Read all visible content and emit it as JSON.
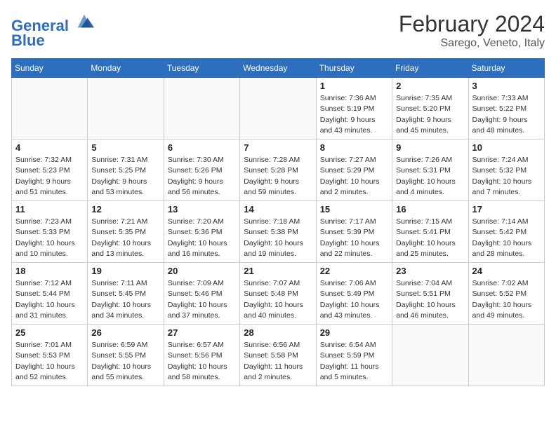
{
  "header": {
    "logo_line1": "General",
    "logo_line2": "Blue",
    "month": "February 2024",
    "location": "Sarego, Veneto, Italy"
  },
  "weekdays": [
    "Sunday",
    "Monday",
    "Tuesday",
    "Wednesday",
    "Thursday",
    "Friday",
    "Saturday"
  ],
  "weeks": [
    [
      {
        "day": "",
        "info": ""
      },
      {
        "day": "",
        "info": ""
      },
      {
        "day": "",
        "info": ""
      },
      {
        "day": "",
        "info": ""
      },
      {
        "day": "1",
        "info": "Sunrise: 7:36 AM\nSunset: 5:19 PM\nDaylight: 9 hours\nand 43 minutes."
      },
      {
        "day": "2",
        "info": "Sunrise: 7:35 AM\nSunset: 5:20 PM\nDaylight: 9 hours\nand 45 minutes."
      },
      {
        "day": "3",
        "info": "Sunrise: 7:33 AM\nSunset: 5:22 PM\nDaylight: 9 hours\nand 48 minutes."
      }
    ],
    [
      {
        "day": "4",
        "info": "Sunrise: 7:32 AM\nSunset: 5:23 PM\nDaylight: 9 hours\nand 51 minutes."
      },
      {
        "day": "5",
        "info": "Sunrise: 7:31 AM\nSunset: 5:25 PM\nDaylight: 9 hours\nand 53 minutes."
      },
      {
        "day": "6",
        "info": "Sunrise: 7:30 AM\nSunset: 5:26 PM\nDaylight: 9 hours\nand 56 minutes."
      },
      {
        "day": "7",
        "info": "Sunrise: 7:28 AM\nSunset: 5:28 PM\nDaylight: 9 hours\nand 59 minutes."
      },
      {
        "day": "8",
        "info": "Sunrise: 7:27 AM\nSunset: 5:29 PM\nDaylight: 10 hours\nand 2 minutes."
      },
      {
        "day": "9",
        "info": "Sunrise: 7:26 AM\nSunset: 5:31 PM\nDaylight: 10 hours\nand 4 minutes."
      },
      {
        "day": "10",
        "info": "Sunrise: 7:24 AM\nSunset: 5:32 PM\nDaylight: 10 hours\nand 7 minutes."
      }
    ],
    [
      {
        "day": "11",
        "info": "Sunrise: 7:23 AM\nSunset: 5:33 PM\nDaylight: 10 hours\nand 10 minutes."
      },
      {
        "day": "12",
        "info": "Sunrise: 7:21 AM\nSunset: 5:35 PM\nDaylight: 10 hours\nand 13 minutes."
      },
      {
        "day": "13",
        "info": "Sunrise: 7:20 AM\nSunset: 5:36 PM\nDaylight: 10 hours\nand 16 minutes."
      },
      {
        "day": "14",
        "info": "Sunrise: 7:18 AM\nSunset: 5:38 PM\nDaylight: 10 hours\nand 19 minutes."
      },
      {
        "day": "15",
        "info": "Sunrise: 7:17 AM\nSunset: 5:39 PM\nDaylight: 10 hours\nand 22 minutes."
      },
      {
        "day": "16",
        "info": "Sunrise: 7:15 AM\nSunset: 5:41 PM\nDaylight: 10 hours\nand 25 minutes."
      },
      {
        "day": "17",
        "info": "Sunrise: 7:14 AM\nSunset: 5:42 PM\nDaylight: 10 hours\nand 28 minutes."
      }
    ],
    [
      {
        "day": "18",
        "info": "Sunrise: 7:12 AM\nSunset: 5:44 PM\nDaylight: 10 hours\nand 31 minutes."
      },
      {
        "day": "19",
        "info": "Sunrise: 7:11 AM\nSunset: 5:45 PM\nDaylight: 10 hours\nand 34 minutes."
      },
      {
        "day": "20",
        "info": "Sunrise: 7:09 AM\nSunset: 5:46 PM\nDaylight: 10 hours\nand 37 minutes."
      },
      {
        "day": "21",
        "info": "Sunrise: 7:07 AM\nSunset: 5:48 PM\nDaylight: 10 hours\nand 40 minutes."
      },
      {
        "day": "22",
        "info": "Sunrise: 7:06 AM\nSunset: 5:49 PM\nDaylight: 10 hours\nand 43 minutes."
      },
      {
        "day": "23",
        "info": "Sunrise: 7:04 AM\nSunset: 5:51 PM\nDaylight: 10 hours\nand 46 minutes."
      },
      {
        "day": "24",
        "info": "Sunrise: 7:02 AM\nSunset: 5:52 PM\nDaylight: 10 hours\nand 49 minutes."
      }
    ],
    [
      {
        "day": "25",
        "info": "Sunrise: 7:01 AM\nSunset: 5:53 PM\nDaylight: 10 hours\nand 52 minutes."
      },
      {
        "day": "26",
        "info": "Sunrise: 6:59 AM\nSunset: 5:55 PM\nDaylight: 10 hours\nand 55 minutes."
      },
      {
        "day": "27",
        "info": "Sunrise: 6:57 AM\nSunset: 5:56 PM\nDaylight: 10 hours\nand 58 minutes."
      },
      {
        "day": "28",
        "info": "Sunrise: 6:56 AM\nSunset: 5:58 PM\nDaylight: 11 hours\nand 2 minutes."
      },
      {
        "day": "29",
        "info": "Sunrise: 6:54 AM\nSunset: 5:59 PM\nDaylight: 11 hours\nand 5 minutes."
      },
      {
        "day": "",
        "info": ""
      },
      {
        "day": "",
        "info": ""
      }
    ]
  ]
}
